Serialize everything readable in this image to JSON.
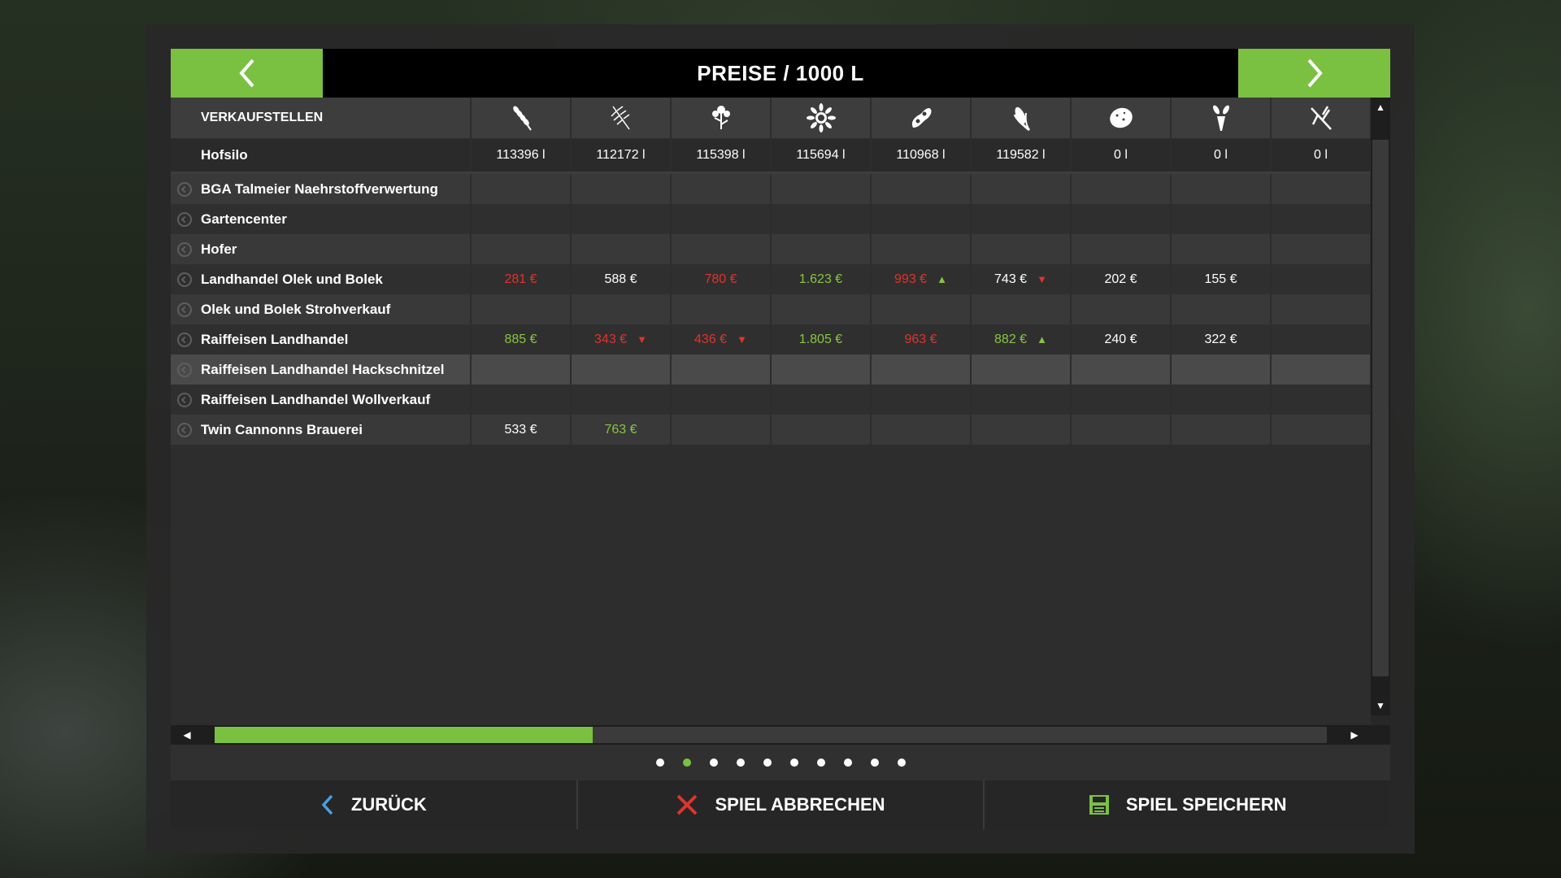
{
  "header": {
    "title": "PREISE / 1000 L"
  },
  "colors": {
    "accent": "#7ac142",
    "price_up": "#86c540",
    "price_down": "#e0332e"
  },
  "columns": {
    "label": "VERKAUFSTELLEN",
    "crops": [
      "wheat-icon",
      "barley-icon",
      "rapeseed-icon",
      "sunflower-icon",
      "soybean-icon",
      "maize-icon",
      "potato-icon",
      "sugarbeet-icon",
      "grass-icon"
    ]
  },
  "storage": {
    "name": "Hofsilo",
    "values": [
      "113396 l",
      "112172 l",
      "115398 l",
      "115694 l",
      "110968 l",
      "119582 l",
      "0 l",
      "0 l",
      "0 l"
    ]
  },
  "stations": [
    {
      "name": "BGA Talmeier Naehrstoffverwertung",
      "cells": [
        null,
        null,
        null,
        null,
        null,
        null,
        null,
        null,
        null
      ]
    },
    {
      "name": "Gartencenter",
      "cells": [
        null,
        null,
        null,
        null,
        null,
        null,
        null,
        null,
        null
      ]
    },
    {
      "name": "Hofer",
      "cells": [
        null,
        null,
        null,
        null,
        null,
        null,
        null,
        null,
        null
      ]
    },
    {
      "name": "Landhandel Olek und Bolek",
      "cells": [
        {
          "v": "281 €",
          "c": "red"
        },
        {
          "v": "588 €",
          "c": "white"
        },
        {
          "v": "780 €",
          "c": "red"
        },
        {
          "v": "1.623 €",
          "c": "green"
        },
        {
          "v": "993 €",
          "c": "red",
          "t": "up"
        },
        {
          "v": "743 €",
          "c": "white",
          "t": "down"
        },
        {
          "v": "202 €",
          "c": "white"
        },
        {
          "v": "155 €",
          "c": "white"
        },
        null
      ]
    },
    {
      "name": "Olek und Bolek Strohverkauf",
      "cells": [
        null,
        null,
        null,
        null,
        null,
        null,
        null,
        null,
        null
      ]
    },
    {
      "name": "Raiffeisen Landhandel",
      "cells": [
        {
          "v": "885 €",
          "c": "green"
        },
        {
          "v": "343 €",
          "c": "red",
          "t": "down"
        },
        {
          "v": "436 €",
          "c": "red",
          "t": "down"
        },
        {
          "v": "1.805 €",
          "c": "green"
        },
        {
          "v": "963 €",
          "c": "red"
        },
        {
          "v": "882 €",
          "c": "green",
          "t": "up"
        },
        {
          "v": "240 €",
          "c": "white"
        },
        {
          "v": "322 €",
          "c": "white"
        },
        null
      ]
    },
    {
      "name": "Raiffeisen Landhandel Hackschnitzel",
      "selected": true,
      "cells": [
        null,
        null,
        null,
        null,
        null,
        null,
        null,
        null,
        null
      ]
    },
    {
      "name": "Raiffeisen Landhandel Wollverkauf",
      "cells": [
        null,
        null,
        null,
        null,
        null,
        null,
        null,
        null,
        null
      ]
    },
    {
      "name": "Twin Cannonns Brauerei",
      "cells": [
        {
          "v": "533 €",
          "c": "white"
        },
        {
          "v": "763 €",
          "c": "green"
        },
        null,
        null,
        null,
        null,
        null,
        null,
        null
      ]
    }
  ],
  "scroll": {
    "horizontal_fraction": 0.34
  },
  "pagination": {
    "count": 10,
    "active_index": 1
  },
  "footer": {
    "back_label": "ZURÜCK",
    "quit_label": "SPIEL ABBRECHEN",
    "save_label": "SPIEL SPEICHERN"
  }
}
